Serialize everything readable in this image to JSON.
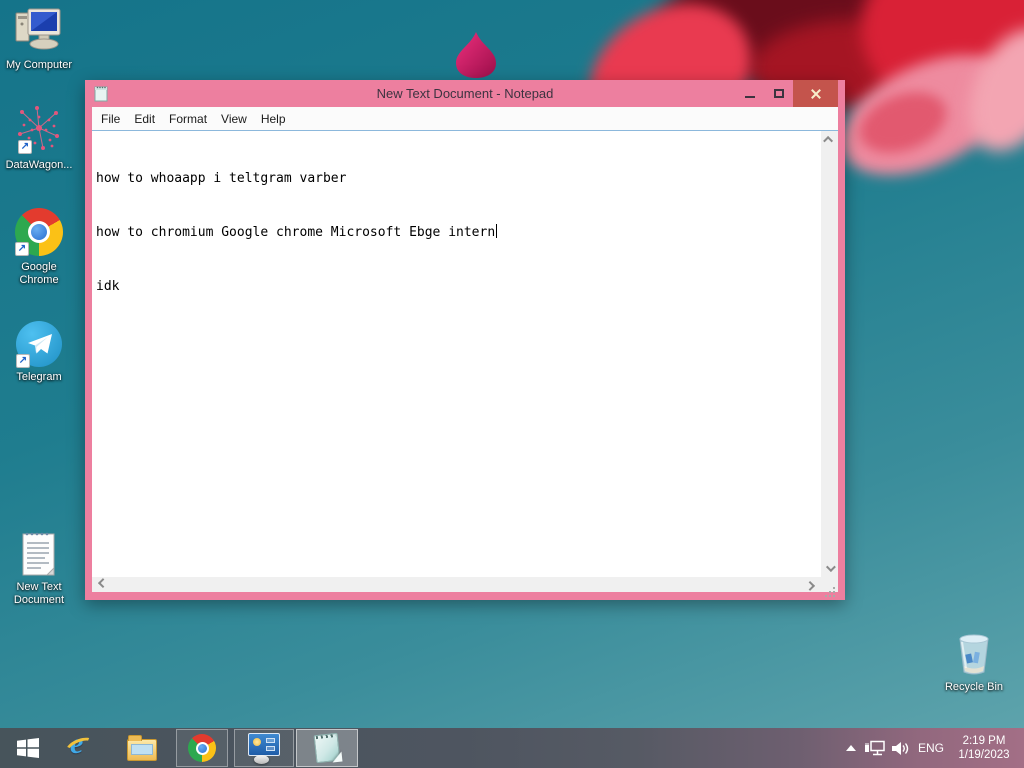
{
  "desktop": {
    "icons": [
      {
        "name": "my-computer",
        "label": "My Computer"
      },
      {
        "name": "datawagon-shortcut",
        "label": "DataWagon..."
      },
      {
        "name": "google-chrome-shortcut",
        "label": "Google Chrome"
      },
      {
        "name": "telegram-shortcut",
        "label": "Telegram"
      },
      {
        "name": "new-text-document",
        "label": "New Text Document"
      },
      {
        "name": "recycle-bin",
        "label": "Recycle Bin"
      }
    ]
  },
  "notepad": {
    "title": "New Text Document - Notepad",
    "menu": [
      "File",
      "Edit",
      "Format",
      "View",
      "Help"
    ],
    "lines": [
      "how to whoaapp i teltgram varber",
      "how to chromium Google chrome Microsoft Ebge intern",
      "idk"
    ]
  },
  "taskbar": {
    "language": "ENG",
    "time": "2:19 PM",
    "date": "1/19/2023"
  },
  "colors": {
    "desktop_teal_top": "#15748A",
    "desktop_teal_bottom": "#62A6AE",
    "window_pink": "#ED7F9F",
    "close_button_red": "#C4544C",
    "flower_red": "#D92136",
    "flower_dark_red": "#6A0D1B",
    "flower_pink": "#EE8B9F",
    "bud_magenta": "#D81A6A",
    "taskbar_left": "#47545B",
    "taskbar_right": "#A36F86",
    "menu_bg": "#FBFBFB",
    "edit_border_blue": "#8CB8DC"
  }
}
